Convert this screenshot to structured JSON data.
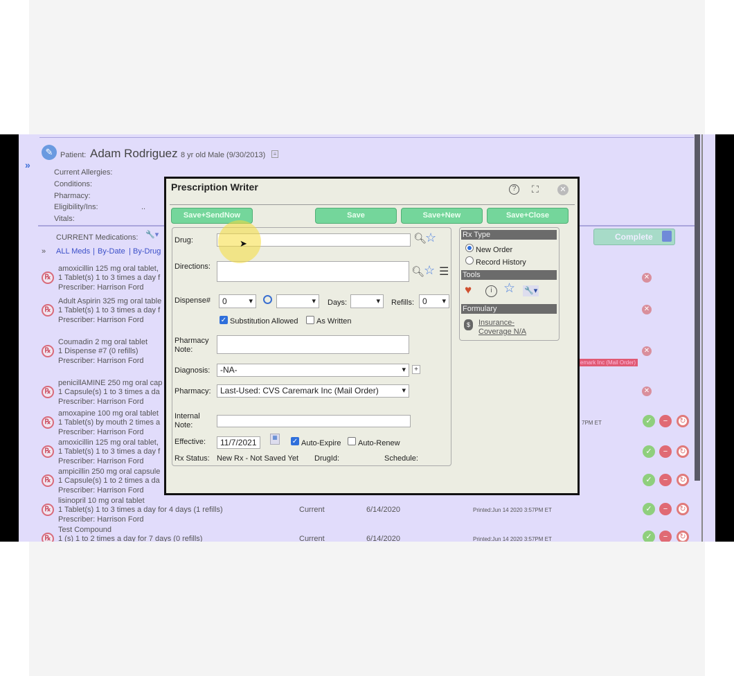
{
  "patient": {
    "label": "Patient:",
    "name": "Adam Rodriguez",
    "info": "8 yr old Male (9/30/2013)",
    "fields": [
      "Current Allergies:",
      "Conditions:",
      "Pharmacy:",
      "Eligibility/Ins:",
      "Vitals:"
    ],
    "eligibility_value": ".."
  },
  "meds": {
    "title": "CURRENT Medications:",
    "filters": [
      "ALL Meds",
      "By-Date",
      "By-Drug"
    ],
    "complete_label": "Complete",
    "items": [
      {
        "name": "amoxicillin 125 mg oral tablet,",
        "sig": "1 Tablet(s) 1 to 3 times a day f",
        "prescriber": "Prescriber: Harrison Ford"
      },
      {
        "name": "Adult Aspirin 325 mg oral table",
        "sig": "1 Tablet(s) 1 to 3 times a day f",
        "prescriber": "Prescriber: Harrison Ford"
      },
      {
        "name": "Coumadin 2 mg oral tablet",
        "sig": "1 Dispense #7 (0 refills)",
        "prescriber": "Prescriber: Harrison Ford"
      },
      {
        "name": "penicillAMINE 250 mg oral cap",
        "sig": "1 Capsule(s) 1 to 3 times a da",
        "prescriber": "Prescriber: Harrison Ford"
      },
      {
        "name": "amoxapine 100 mg oral tablet",
        "sig": "1 Tablet(s) by mouth 2 times a",
        "prescriber": "Prescriber: Harrison Ford"
      },
      {
        "name": "amoxicillin 125 mg oral tablet,",
        "sig": "1 Tablet(s) 1 to 3 times a day f",
        "prescriber": "Prescriber: Harrison Ford"
      },
      {
        "name": "ampicillin 250 mg oral capsule",
        "sig": "1 Capsule(s) 1 to 2 times a da",
        "prescriber": "Prescriber: Harrison Ford"
      },
      {
        "name": "lisinopril 10 mg oral tablet",
        "sig": "1 Tablet(s) 1 to 3 times a day for 4 days (1 refills)",
        "prescriber": "Prescriber: Harrison Ford",
        "status": "Current",
        "date": "6/14/2020",
        "printed": "Printed:Jun 14 2020 3:57PM ET"
      },
      {
        "name": "Test Compound",
        "sig": "1 (s) 1 to 2 times a day for 7 days (0 refills)",
        "status": "Current",
        "date": "6/14/2020",
        "printed": "Printed:Jun 14 2020 3:57PM ET"
      }
    ],
    "partial_printed": "7PM ET",
    "pharmacy_tag": "emark Inc (Mail Order)"
  },
  "modal": {
    "title": "Prescription Writer",
    "buttons": {
      "send": "Save+SendNow",
      "save": "Save",
      "save_new": "Save+New",
      "save_close": "Save+Close"
    },
    "drug_label": "Drug:",
    "drug_value": "",
    "directions_label": "Directions:",
    "directions_value": "",
    "dispense_label": "Dispense#",
    "dispense_value": "0",
    "unit_value": "",
    "days_label": "Days:",
    "days_value": "",
    "refills_label": "Refills:",
    "refills_value": "0",
    "substitution_label": "Substitution Allowed",
    "substitution_checked": true,
    "as_written_label": "As Written",
    "as_written_checked": false,
    "pharmacy_note_label": "Pharmacy Note:",
    "diagnosis_label": "Diagnosis:",
    "diagnosis_value": "-NA-",
    "pharmacy_label": "Pharmacy:",
    "pharmacy_value": "Last-Used: CVS Caremark Inc (Mail Order)",
    "internal_note_label": "Internal Note:",
    "effective_label": "Effective:",
    "effective_value": "11/7/2021",
    "auto_expire_label": "Auto-Expire",
    "auto_expire_checked": true,
    "auto_renew_label": "Auto-Renew",
    "auto_renew_checked": false,
    "rx_status_label": "Rx Status:",
    "rx_status_value": "New Rx - Not Saved Yet",
    "drugid_label": "DrugId:",
    "schedule_label": "Schedule:",
    "rx_type_header": "Rx Type",
    "new_order_label": "New Order",
    "new_order_selected": true,
    "record_history_label": "Record History",
    "tools_header": "Tools",
    "formulary_header": "Formulary",
    "insurance_link": "Insurance-Coverage N/A"
  }
}
